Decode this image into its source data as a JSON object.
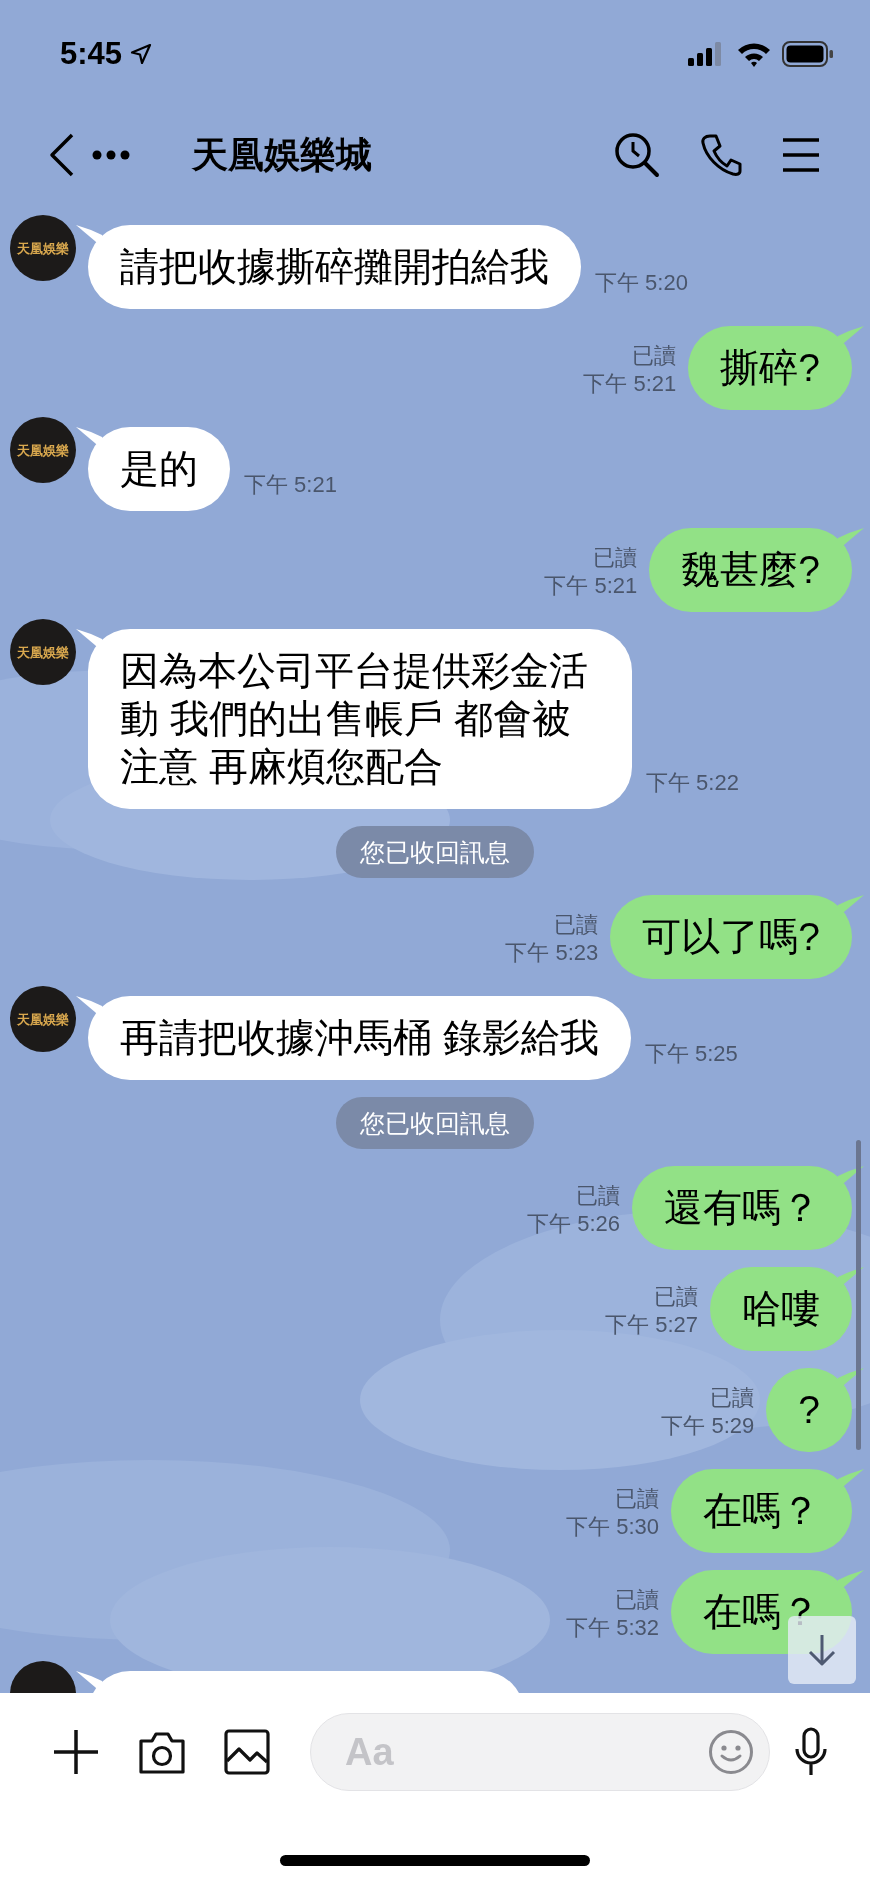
{
  "status_bar": {
    "time": "5:45"
  },
  "header": {
    "title": "天凰娛樂城"
  },
  "messages": [
    {
      "kind": "incoming",
      "avatar": "天凰娛樂",
      "text": "請把收據撕碎攤開拍給我",
      "time": "下午 5:20"
    },
    {
      "kind": "outgoing",
      "text": "撕碎?",
      "read": "已讀",
      "time": "下午 5:21"
    },
    {
      "kind": "incoming",
      "avatar": "天凰娛樂",
      "text": "是的",
      "time": "下午 5:21"
    },
    {
      "kind": "outgoing",
      "text": "魏甚麼?",
      "read": "已讀",
      "time": "下午 5:21"
    },
    {
      "kind": "incoming",
      "avatar": "天凰娛樂",
      "text": "因為本公司平台提供彩金活動 我們的出售帳戶 都會被注意 再麻煩您配合",
      "time": "下午 5:22"
    },
    {
      "kind": "notice",
      "text": "您已收回訊息"
    },
    {
      "kind": "outgoing",
      "text": "可以了嗎?",
      "read": "已讀",
      "time": "下午 5:23"
    },
    {
      "kind": "incoming",
      "avatar": "天凰娛樂",
      "text": "再請把收據沖馬桶 錄影給我",
      "time": "下午 5:25"
    },
    {
      "kind": "notice",
      "text": "您已收回訊息"
    },
    {
      "kind": "outgoing",
      "text": "還有嗎？",
      "read": "已讀",
      "time": "下午 5:26"
    },
    {
      "kind": "outgoing",
      "text": "哈嘍",
      "read": "已讀",
      "time": "下午 5:27"
    },
    {
      "kind": "outgoing",
      "text": "?",
      "read": "已讀",
      "time": "下午 5:29"
    },
    {
      "kind": "outgoing",
      "text": "在嗎？",
      "read": "已讀",
      "time": "下午 5:30"
    },
    {
      "kind": "outgoing",
      "text": "在嗎？",
      "read": "已讀",
      "time": "下午 5:32"
    },
    {
      "kind": "incoming"
    }
  ],
  "composer": {
    "placeholder": "Aa"
  }
}
